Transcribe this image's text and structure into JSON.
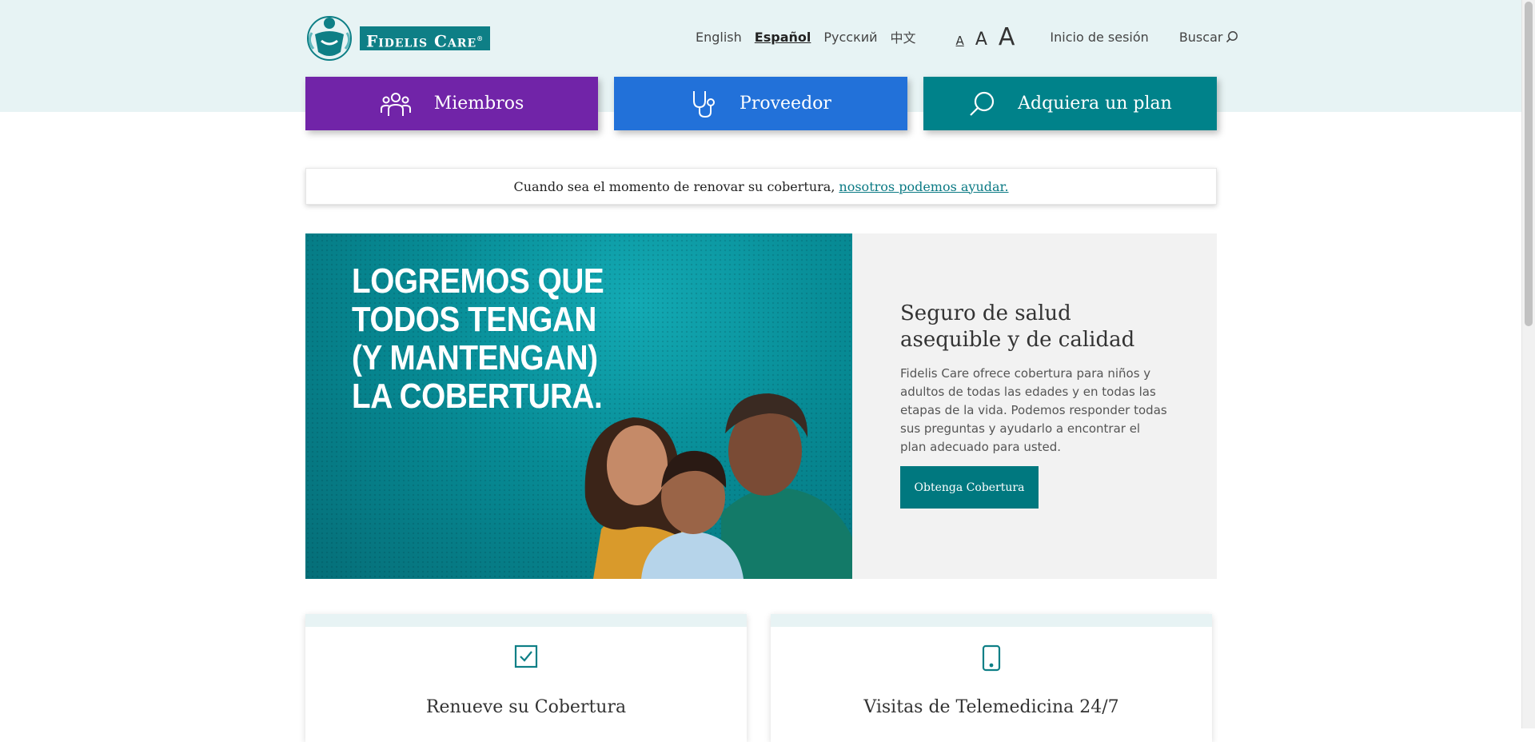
{
  "header": {
    "logo_text": "Fidelis Care",
    "logo_mark": "®",
    "languages": [
      {
        "label": "English",
        "active": false
      },
      {
        "label": "Español",
        "active": true
      },
      {
        "label": "Русский",
        "active": false
      },
      {
        "label": "中文",
        "active": false
      }
    ],
    "text_sizes": [
      "A",
      "A",
      "A"
    ],
    "login_label": "Inicio de sesión",
    "search_label": "Buscar",
    "search_icon": "search-icon"
  },
  "nav": {
    "members": {
      "label": "Miembros",
      "icon": "people-icon",
      "color": "#7124a8"
    },
    "provider": {
      "label": "Proveedor",
      "icon": "stethoscope-icon",
      "color": "#2271d9"
    },
    "plan": {
      "label": "Adquiera un plan",
      "icon": "search-icon",
      "color": "#00828a"
    }
  },
  "alert": {
    "text": "Cuando sea el momento de renovar su cobertura,",
    "link": "nosotros podemos ayudar."
  },
  "hero": {
    "headline": "LOGREMOS QUE TODOS TENGAN (Y MANTENGAN) LA COBERTURA.",
    "title": "Seguro de salud asequible y de calidad",
    "body": "Fidelis Care ofrece cobertura para niños y adultos de todas las edades y en todas las etapas de la vida. Podemos responder todas sus preguntas y ayudarlo a encontrar el plan adecuado para usted.",
    "cta": "Obtenga Cobertura",
    "accent": "#00787f"
  },
  "cards": [
    {
      "title": "Renueve su Cobertura",
      "icon": "checkbox-icon"
    },
    {
      "title": "Visitas de Telemedicina 24/7",
      "icon": "mobile-phone-icon"
    }
  ]
}
